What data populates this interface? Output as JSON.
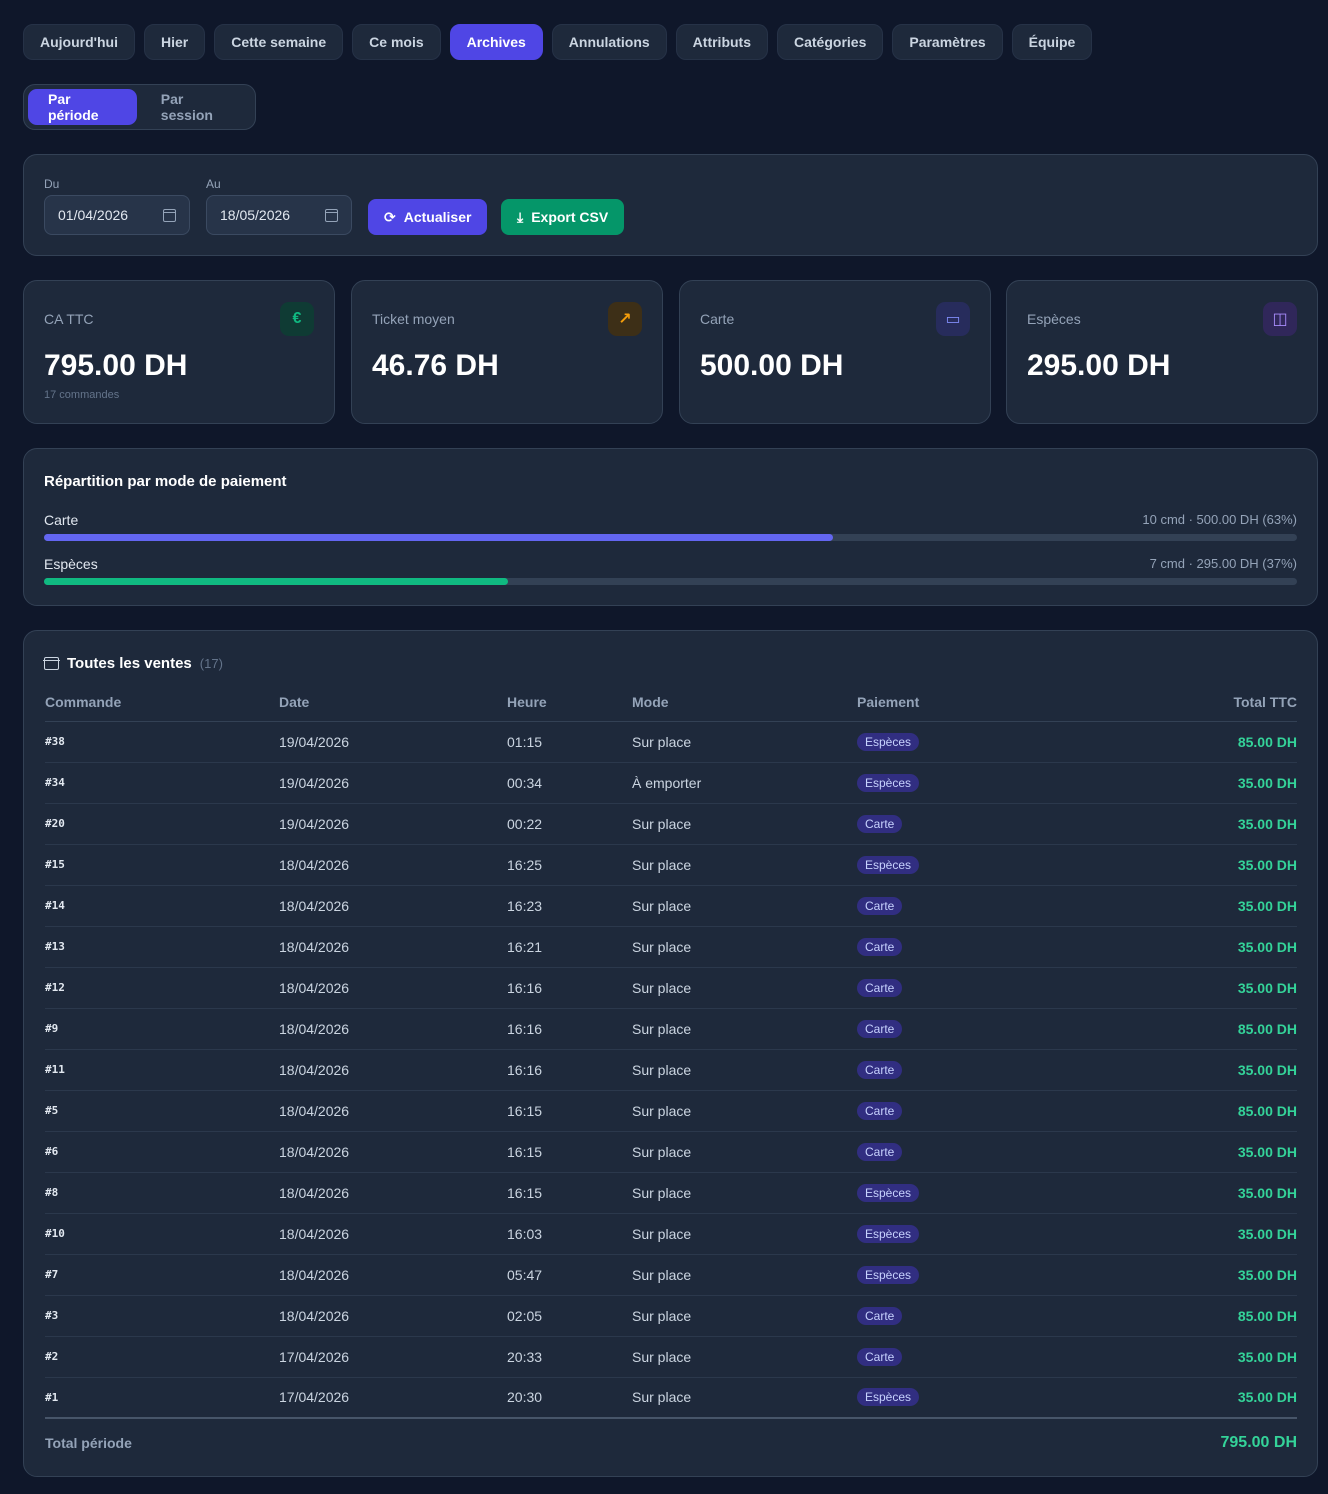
{
  "nav": {
    "tabs": [
      {
        "label": "Aujourd'hui",
        "active": false
      },
      {
        "label": "Hier",
        "active": false
      },
      {
        "label": "Cette semaine",
        "active": false
      },
      {
        "label": "Ce mois",
        "active": false
      },
      {
        "label": "Archives",
        "active": true
      },
      {
        "label": "Annulations",
        "active": false
      },
      {
        "label": "Attributs",
        "active": false
      },
      {
        "label": "Catégories",
        "active": false
      },
      {
        "label": "Paramètres",
        "active": false
      },
      {
        "label": "Équipe",
        "active": false
      }
    ]
  },
  "view_toggle": {
    "by_period": "Par période",
    "by_session": "Par session"
  },
  "filter": {
    "from_label": "Du",
    "from_value": "01/04/2026",
    "to_label": "Au",
    "to_value": "18/05/2026",
    "refresh_label": "Actualiser",
    "export_label": "Export CSV"
  },
  "stats": {
    "revenue": {
      "label": "CA TTC",
      "value": "795.00 DH",
      "sub": "17 commandes",
      "icon": "euro-icon",
      "color": "#10b981"
    },
    "avg_ticket": {
      "label": "Ticket moyen",
      "value": "46.76 DH",
      "icon": "trending-up-icon",
      "color": "#f59e0b"
    },
    "card": {
      "label": "Carte",
      "value": "500.00 DH",
      "icon": "credit-card-icon",
      "color": "#818cf8"
    },
    "cash": {
      "label": "Espèces",
      "value": "295.00 DH",
      "icon": "shopping-bag-icon",
      "color": "#a78bfa"
    }
  },
  "payment_split": {
    "title": "Répartition par mode de paiement",
    "rows": [
      {
        "name": "Carte",
        "info": "10 cmd · 500.00 DH (63%)",
        "percent": 63,
        "color": "#6366f1"
      },
      {
        "name": "Espèces",
        "info": "7 cmd · 295.00 DH (37%)",
        "percent": 37,
        "color": "#10b981"
      }
    ]
  },
  "sales": {
    "title": "Toutes les ventes",
    "count": "(17)",
    "columns": [
      "Commande",
      "Date",
      "Heure",
      "Mode",
      "Paiement",
      "Total TTC"
    ],
    "rows": [
      {
        "order": "#38",
        "date": "19/04/2026",
        "time": "01:15",
        "mode": "Sur place",
        "payment": "Espèces",
        "total": "85.00 DH"
      },
      {
        "order": "#34",
        "date": "19/04/2026",
        "time": "00:34",
        "mode": "À emporter",
        "payment": "Espèces",
        "total": "35.00 DH"
      },
      {
        "order": "#20",
        "date": "19/04/2026",
        "time": "00:22",
        "mode": "Sur place",
        "payment": "Carte",
        "total": "35.00 DH"
      },
      {
        "order": "#15",
        "date": "18/04/2026",
        "time": "16:25",
        "mode": "Sur place",
        "payment": "Espèces",
        "total": "35.00 DH"
      },
      {
        "order": "#14",
        "date": "18/04/2026",
        "time": "16:23",
        "mode": "Sur place",
        "payment": "Carte",
        "total": "35.00 DH"
      },
      {
        "order": "#13",
        "date": "18/04/2026",
        "time": "16:21",
        "mode": "Sur place",
        "payment": "Carte",
        "total": "35.00 DH"
      },
      {
        "order": "#12",
        "date": "18/04/2026",
        "time": "16:16",
        "mode": "Sur place",
        "payment": "Carte",
        "total": "35.00 DH"
      },
      {
        "order": "#9",
        "date": "18/04/2026",
        "time": "16:16",
        "mode": "Sur place",
        "payment": "Carte",
        "total": "85.00 DH"
      },
      {
        "order": "#11",
        "date": "18/04/2026",
        "time": "16:16",
        "mode": "Sur place",
        "payment": "Carte",
        "total": "35.00 DH"
      },
      {
        "order": "#5",
        "date": "18/04/2026",
        "time": "16:15",
        "mode": "Sur place",
        "payment": "Carte",
        "total": "85.00 DH"
      },
      {
        "order": "#6",
        "date": "18/04/2026",
        "time": "16:15",
        "mode": "Sur place",
        "payment": "Carte",
        "total": "35.00 DH"
      },
      {
        "order": "#8",
        "date": "18/04/2026",
        "time": "16:15",
        "mode": "Sur place",
        "payment": "Espèces",
        "total": "35.00 DH"
      },
      {
        "order": "#10",
        "date": "18/04/2026",
        "time": "16:03",
        "mode": "Sur place",
        "payment": "Espèces",
        "total": "35.00 DH"
      },
      {
        "order": "#7",
        "date": "18/04/2026",
        "time": "05:47",
        "mode": "Sur place",
        "payment": "Espèces",
        "total": "35.00 DH"
      },
      {
        "order": "#3",
        "date": "18/04/2026",
        "time": "02:05",
        "mode": "Sur place",
        "payment": "Carte",
        "total": "85.00 DH"
      },
      {
        "order": "#2",
        "date": "17/04/2026",
        "time": "20:33",
        "mode": "Sur place",
        "payment": "Carte",
        "total": "35.00 DH"
      },
      {
        "order": "#1",
        "date": "17/04/2026",
        "time": "20:30",
        "mode": "Sur place",
        "payment": "Espèces",
        "total": "35.00 DH"
      }
    ],
    "footer_label": "Total période",
    "footer_total": "795.00 DH"
  }
}
